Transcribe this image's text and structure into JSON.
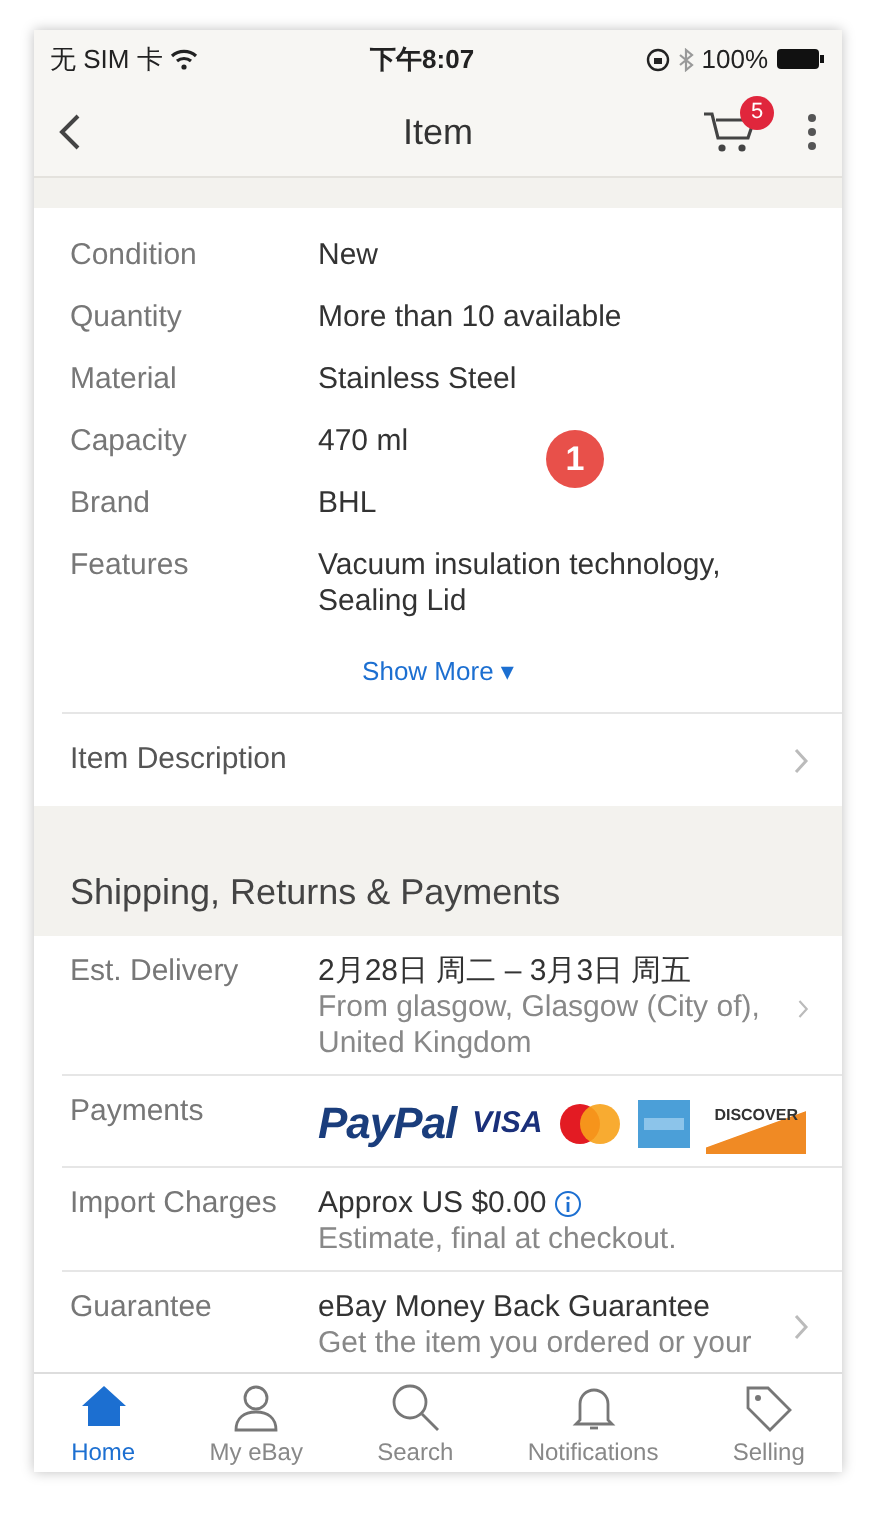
{
  "status_bar": {
    "carrier": "无 SIM 卡",
    "time": "下午8:07",
    "battery": "100%"
  },
  "nav": {
    "title": "Item",
    "cart_count": "5"
  },
  "specifics": [
    {
      "label": "Condition",
      "value": "New"
    },
    {
      "label": "Quantity",
      "value": "More than 10 available"
    },
    {
      "label": "Material",
      "value": "Stainless Steel"
    },
    {
      "label": "Capacity",
      "value": "470 ml"
    },
    {
      "label": "Brand",
      "value": "BHL"
    },
    {
      "label": "Features",
      "value": "Vacuum insulation technology, Sealing Lid"
    }
  ],
  "annotation": "1",
  "show_more": "Show More ▾",
  "item_description": "Item Description",
  "shipping": {
    "title": "Shipping, Returns & Payments",
    "delivery": {
      "label": "Est. Delivery",
      "value": "2月28日 周二 – 3月3日 周五",
      "note": "From glasgow, Glasgow (City of), United Kingdom"
    },
    "payments": {
      "label": "Payments",
      "methods": [
        {
          "kind": "paypal",
          "label": "PayPal"
        },
        {
          "kind": "visa",
          "label": "VISA"
        },
        {
          "kind": "mastercard"
        },
        {
          "kind": "amex"
        },
        {
          "kind": "discover",
          "label": "DISCOVER"
        }
      ]
    },
    "import": {
      "label": "Import Charges",
      "value": "Approx US $0.00",
      "note": "Estimate, final at checkout."
    },
    "guarantee": {
      "label": "Guarantee",
      "value": "eBay Money Back Guarantee",
      "note": "Get the item you ordered or your"
    }
  },
  "tabs": [
    {
      "kind": "home",
      "label": "Home",
      "selected": true
    },
    {
      "kind": "person",
      "label": "My eBay",
      "selected": false
    },
    {
      "kind": "search",
      "label": "Search",
      "selected": false
    },
    {
      "kind": "bell",
      "label": "Notifications",
      "selected": false
    },
    {
      "kind": "tag",
      "label": "Selling",
      "selected": false
    }
  ]
}
